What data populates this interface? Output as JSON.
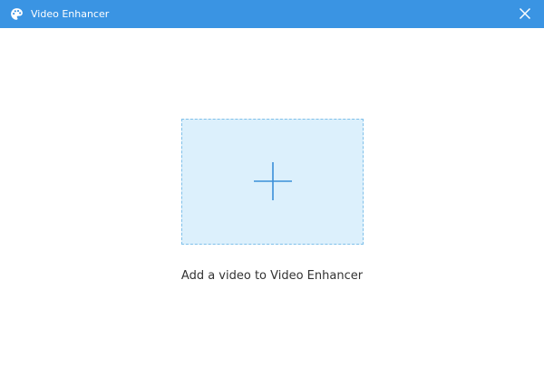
{
  "window": {
    "title": "Video Enhancer",
    "app_icon": "palette-icon",
    "close_icon": "close-icon"
  },
  "main": {
    "add_icon": "plus-icon",
    "hint": "Add a video to Video Enhancer"
  },
  "colors": {
    "titlebar": "#3a94e3",
    "drop_zone_fill": "#dcf0fc",
    "drop_zone_border": "#7fc0ea",
    "plus": "#3a8fd8"
  }
}
